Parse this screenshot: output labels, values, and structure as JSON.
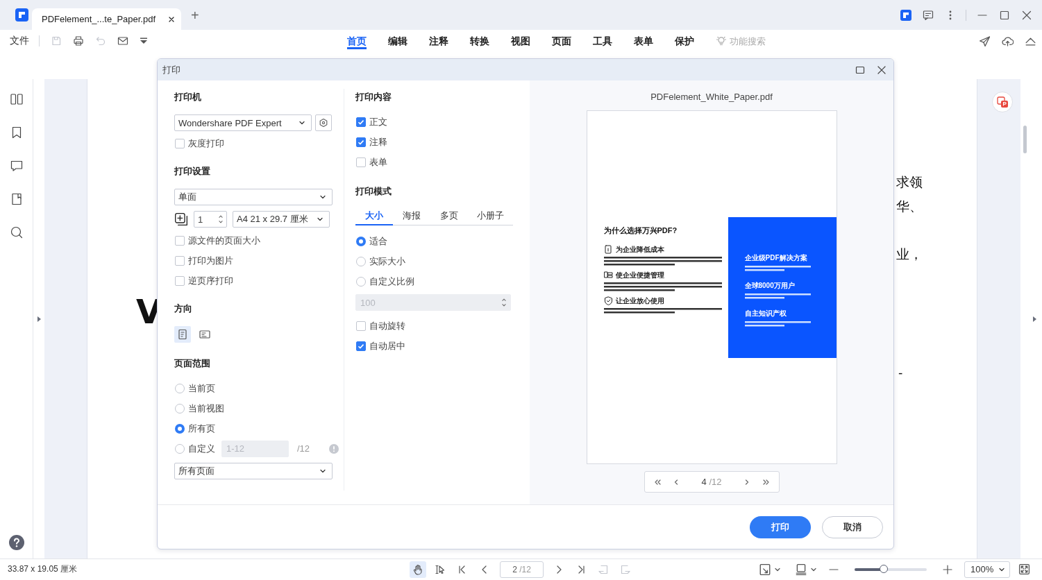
{
  "tabs": [
    {
      "label": "PDFelement_...te_Paper.pdf",
      "selected": true
    }
  ],
  "new_tab": "+",
  "toolbar": {
    "file_menu": "文件",
    "ribbon": [
      {
        "label": "首页",
        "selected": true
      },
      {
        "label": "编辑",
        "selected": false
      },
      {
        "label": "注释",
        "selected": false
      },
      {
        "label": "转换",
        "selected": false
      },
      {
        "label": "视图",
        "selected": false
      },
      {
        "label": "页面",
        "selected": false
      },
      {
        "label": "工具",
        "selected": false
      },
      {
        "label": "表单",
        "selected": false
      },
      {
        "label": "保护",
        "selected": false
      }
    ],
    "feature_search": {
      "placeholder": "功能搜索"
    }
  },
  "document": {
    "fragments": [
      {
        "text": "V",
        "kind": "heading"
      },
      {
        "text": "求领",
        "kind": "body"
      },
      {
        "text": "华、",
        "kind": "body"
      },
      {
        "text": "业，",
        "kind": "body"
      },
      {
        "text": "-",
        "kind": "body"
      }
    ]
  },
  "print_dialog": {
    "title": "打印",
    "printer": {
      "heading": "打印机",
      "value": "Wondershare PDF Expert",
      "options": [
        {
          "label": "灰度打印",
          "checked": false
        }
      ]
    },
    "settings": {
      "heading": "打印设置",
      "duplex": "单面",
      "copies": "1",
      "paper": "A4 21 x 29.7 厘米",
      "options": [
        {
          "label": "源文件的页面大小",
          "checked": false
        },
        {
          "label": "打印为图片",
          "checked": false
        },
        {
          "label": "逆页序打印",
          "checked": false
        }
      ]
    },
    "orientation": {
      "heading": "方向",
      "items": [
        {
          "kind": "portrait",
          "selected": true
        },
        {
          "kind": "landscape",
          "selected": false
        }
      ]
    },
    "page_range": {
      "heading": "页面范围",
      "items": [
        {
          "label": "当前页",
          "selected": false
        },
        {
          "label": "当前视图",
          "selected": false
        },
        {
          "label": "所有页",
          "selected": true
        },
        {
          "label": "自定义",
          "selected": false
        }
      ],
      "custom_range": {
        "placeholder": "1-12",
        "disabled": true
      },
      "total": "/12",
      "subset": "所有页面"
    },
    "content": {
      "heading": "打印内容",
      "items": [
        {
          "label": "正文",
          "checked": true
        },
        {
          "label": "注释",
          "checked": true
        },
        {
          "label": "表单",
          "checked": false
        }
      ]
    },
    "mode": {
      "heading": "打印模式",
      "tabs": [
        {
          "label": "大小",
          "selected": true
        },
        {
          "label": "海报",
          "selected": false
        },
        {
          "label": "多页",
          "selected": false
        },
        {
          "label": "小册子",
          "selected": false
        }
      ],
      "scale": [
        {
          "label": "适合",
          "selected": true
        },
        {
          "label": "实际大小",
          "selected": false
        },
        {
          "label": "自定义比例",
          "selected": false
        }
      ],
      "custom_scale": {
        "placeholder": "100",
        "disabled": true
      },
      "options": [
        {
          "label": "自动旋转",
          "checked": false
        },
        {
          "label": "自动居中",
          "checked": true
        }
      ]
    },
    "preview": {
      "file_name": "PDFelement_White_Paper.pdf",
      "page": {
        "title": "为什么选择万兴PDF?",
        "section_headings": [
          "为企业降低成本",
          "使企业便捷管理",
          "让企业放心使用"
        ],
        "panel_headings": [
          "企业级PDF解决方案",
          "全球8000万用户",
          "自主知识产权"
        ]
      },
      "pager": {
        "current": "4",
        "total": "/12"
      }
    },
    "buttons": [
      {
        "label": "打印",
        "kind": "primary"
      },
      {
        "label": "取消",
        "kind": "secondary"
      }
    ]
  },
  "status_bar": {
    "dimensions": "33.87 x 19.05 厘米",
    "page": "2",
    "total": "/12",
    "zoom": {
      "level": 0.4,
      "value": "100%"
    }
  }
}
